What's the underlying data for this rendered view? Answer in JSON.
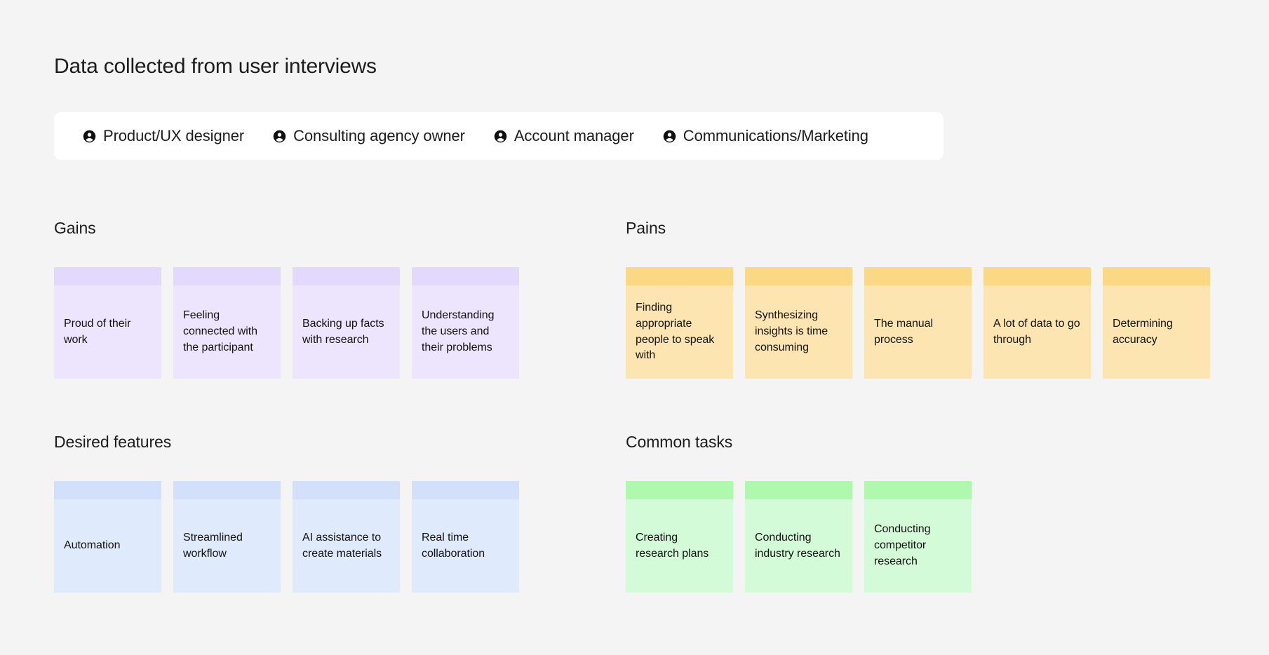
{
  "page": {
    "title": "Data collected from user interviews",
    "background_color": "#f4f4f4"
  },
  "tabs": {
    "icon": "person-circle-icon",
    "items": [
      {
        "label": "Product/UX designer",
        "selected": true
      },
      {
        "label": "Consulting agency owner",
        "selected": false
      },
      {
        "label": "Account manager",
        "selected": false
      },
      {
        "label": "Communications/Marketing",
        "selected": false
      }
    ]
  },
  "sections": [
    {
      "id": "gains",
      "title": "Gains",
      "palette": "purple",
      "strip_color": "#e2d9fc",
      "body_color": "#ece5fd",
      "cards": [
        {
          "text": "Proud of their work"
        },
        {
          "text": "Feeling connected with the participant"
        },
        {
          "text": "Backing up facts with research"
        },
        {
          "text": "Understanding the users and their problems"
        }
      ]
    },
    {
      "id": "pains",
      "title": "Pains",
      "palette": "yellow",
      "strip_color": "#fbd884",
      "body_color": "#fce5b0",
      "cards": [
        {
          "text": "Finding appropriate people to speak with"
        },
        {
          "text": "Synthesizing insights is time consuming"
        },
        {
          "text": "The manual process"
        },
        {
          "text": "A lot of data to go through"
        },
        {
          "text": "Determining accuracy"
        }
      ]
    },
    {
      "id": "desired",
      "title": "Desired features",
      "palette": "blue",
      "strip_color": "#d2e0fc",
      "body_color": "#e0eafd",
      "cards": [
        {
          "text": "Automation"
        },
        {
          "text": "Streamlined workflow"
        },
        {
          "text": "AI assistance to create materials"
        },
        {
          "text": "Real time collaboration"
        }
      ]
    },
    {
      "id": "tasks",
      "title": "Common tasks",
      "palette": "green",
      "strip_color": "#aef9ae",
      "body_color": "#d4fbd7",
      "cards": [
        {
          "text": "Creating research plans"
        },
        {
          "text": "Conducting industry research"
        },
        {
          "text": "Conducting competitor research"
        }
      ]
    }
  ]
}
